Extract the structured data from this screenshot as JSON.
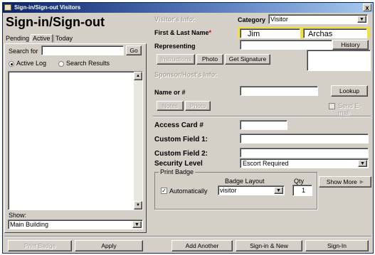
{
  "window": {
    "title": "Sign-in/Sign-out Visitors",
    "close_glyph": "x"
  },
  "left": {
    "heading": "Sign-in/Sign-out",
    "tabs": [
      {
        "label": "Pending",
        "active": false
      },
      {
        "label": "Active",
        "active": true
      },
      {
        "label": "Today",
        "active": false
      }
    ],
    "search_label": "Search for",
    "search_value": "",
    "go_label": "Go",
    "radio_active_log": "Active Log",
    "radio_search_results": "Search Results",
    "show_label": "Show:",
    "show_value": "Main Building"
  },
  "right": {
    "visitor_info_title": "Visitor's Info:",
    "category_label": "Category",
    "category_value": "Visitor",
    "name_label": "First & Last Name",
    "required_mark": "*",
    "first_name": "Jim",
    "last_name": "Archas",
    "representing_label": "Representing",
    "representing_value": "",
    "history_label": "History",
    "instructions_label": "Instructions",
    "photo_label": "Photo",
    "get_signature_label": "Get Signature",
    "sponsor_info_title": "Sponsor/Host's Info:",
    "name_or_num_label": "Name or #",
    "name_or_num_value": "",
    "lookup_label": "Lookup",
    "notes_label": "Notes",
    "photo2_label": "Photo",
    "send_email_label": "Send E-mail",
    "access_card_label": "Access Card #",
    "custom1_label": "Custom Field 1:",
    "custom2_label": "Custom Field 2:",
    "security_label": "Security Level",
    "security_value": "Escort Required",
    "print_badge_title": "Print Badge",
    "automatically_label": "Automatically",
    "badge_layout_label": "Badge Layout",
    "badge_layout_value": "visitor",
    "qty_label": "Qty",
    "qty_value": "1",
    "show_more_label": "Show More"
  },
  "footer": {
    "print_badge": "Print Badge",
    "apply": "Apply",
    "add_another": "Add Another",
    "sign_in_new": "Sign-in & New",
    "sign_in": "Sign-In"
  },
  "colors": {
    "title_bar": "#0a246a",
    "required": "#cc0000",
    "highlight": "#f0e040"
  }
}
